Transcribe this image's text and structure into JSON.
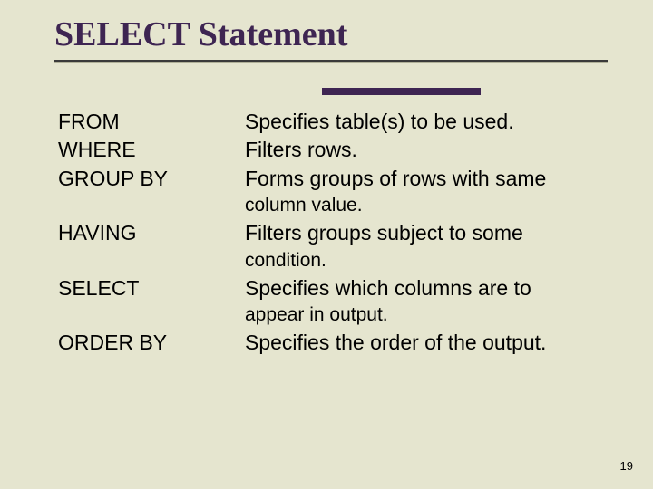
{
  "title": "SELECT Statement",
  "rows": [
    {
      "keyword": "FROM",
      "desc": "Specifies table(s) to be used."
    },
    {
      "keyword": "WHERE",
      "desc": "Filters rows."
    },
    {
      "keyword": "GROUP BY",
      "desc": "Forms groups of rows with same"
    },
    {
      "keyword": "",
      "desc": "column value.",
      "sub": true
    },
    {
      "keyword": "HAVING",
      "desc": "Filters groups subject to some"
    },
    {
      "keyword": "",
      "desc": "condition.",
      "sub": true
    },
    {
      "keyword": "SELECT",
      "desc": "Specifies which columns are to"
    },
    {
      "keyword": "",
      "desc": "appear in output.",
      "sub": true
    },
    {
      "keyword": "ORDER BY",
      "desc": "Specifies the order of the output."
    }
  ],
  "page_number": "19"
}
